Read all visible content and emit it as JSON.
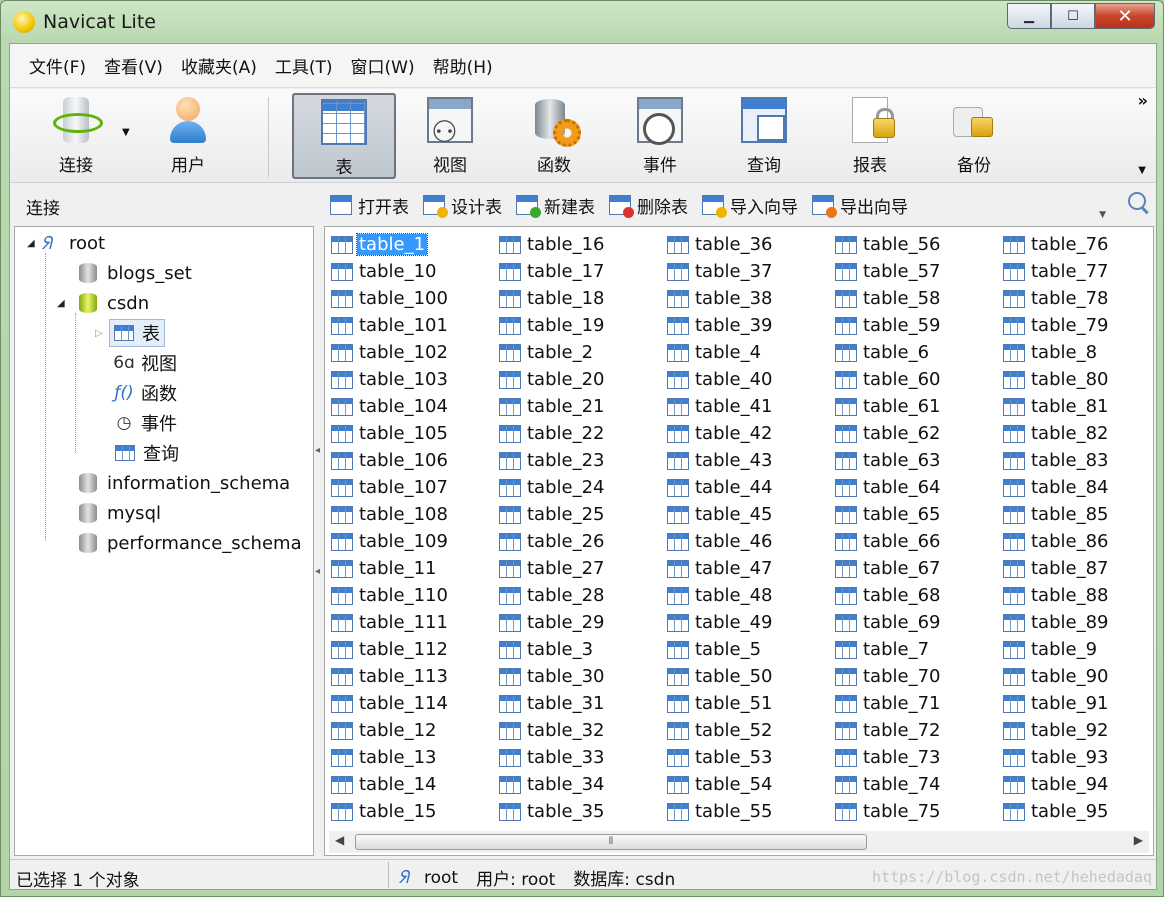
{
  "window": {
    "title": "Navicat Lite"
  },
  "menu": [
    "文件(F)",
    "查看(V)",
    "收藏夹(A)",
    "工具(T)",
    "窗口(W)",
    "帮助(H)"
  ],
  "toolbar": {
    "buttons": [
      {
        "label": "连接",
        "icon": "connection-icon"
      },
      {
        "label": "用户",
        "icon": "user-icon"
      },
      {
        "label": "表",
        "icon": "table-icon",
        "active": true
      },
      {
        "label": "视图",
        "icon": "view-icon"
      },
      {
        "label": "函数",
        "icon": "function-icon"
      },
      {
        "label": "事件",
        "icon": "event-icon"
      },
      {
        "label": "查询",
        "icon": "query-icon"
      },
      {
        "label": "报表",
        "icon": "report-icon"
      },
      {
        "label": "备份",
        "icon": "backup-icon"
      }
    ],
    "overflow": "»"
  },
  "left_header": "连接",
  "tree": [
    {
      "label": "root"
    },
    {
      "label": "blogs_set"
    },
    {
      "label": "csdn"
    },
    {
      "label": "表"
    },
    {
      "label": "视图"
    },
    {
      "label": "函数"
    },
    {
      "label": "事件"
    },
    {
      "label": "查询"
    },
    {
      "label": "information_schema"
    },
    {
      "label": "mysql"
    },
    {
      "label": "performance_schema"
    }
  ],
  "object_toolbar": [
    "打开表",
    "设计表",
    "新建表",
    "删除表",
    "导入向导",
    "导出向导"
  ],
  "tables": [
    "table_1",
    "table_10",
    "table_100",
    "table_101",
    "table_102",
    "table_103",
    "table_104",
    "table_105",
    "table_106",
    "table_107",
    "table_108",
    "table_109",
    "table_11",
    "table_110",
    "table_111",
    "table_112",
    "table_113",
    "table_114",
    "table_12",
    "table_13",
    "table_14",
    "table_15",
    "table_16",
    "table_17",
    "table_18",
    "table_19",
    "table_2",
    "table_20",
    "table_21",
    "table_22",
    "table_23",
    "table_24",
    "table_25",
    "table_26",
    "table_27",
    "table_28",
    "table_29",
    "table_3",
    "table_30",
    "table_31",
    "table_32",
    "table_33",
    "table_34",
    "table_35",
    "table_36",
    "table_37",
    "table_38",
    "table_39",
    "table_4",
    "table_40",
    "table_41",
    "table_42",
    "table_43",
    "table_44",
    "table_45",
    "table_46",
    "table_47",
    "table_48",
    "table_49",
    "table_5",
    "table_50",
    "table_51",
    "table_52",
    "table_53",
    "table_54",
    "table_55",
    "table_56",
    "table_57",
    "table_58",
    "table_59",
    "table_6",
    "table_60",
    "table_61",
    "table_62",
    "table_63",
    "table_64",
    "table_65",
    "table_66",
    "table_67",
    "table_68",
    "table_69",
    "table_7",
    "table_70",
    "table_71",
    "table_72",
    "table_73",
    "table_74",
    "table_75",
    "table_76",
    "table_77",
    "table_78",
    "table_79",
    "table_8",
    "table_80",
    "table_81",
    "table_82",
    "table_83",
    "table_84",
    "table_85",
    "table_86",
    "table_87",
    "table_88",
    "table_89",
    "table_9",
    "table_90",
    "table_91",
    "table_92",
    "table_93",
    "table_94",
    "table_95"
  ],
  "selected_table": "table_1",
  "status": {
    "selection": "已选择 1 个对象",
    "connection": "root",
    "user": "用户: root",
    "database": "数据库: csdn",
    "watermark": "https://blog.csdn.net/hehedadaq"
  }
}
